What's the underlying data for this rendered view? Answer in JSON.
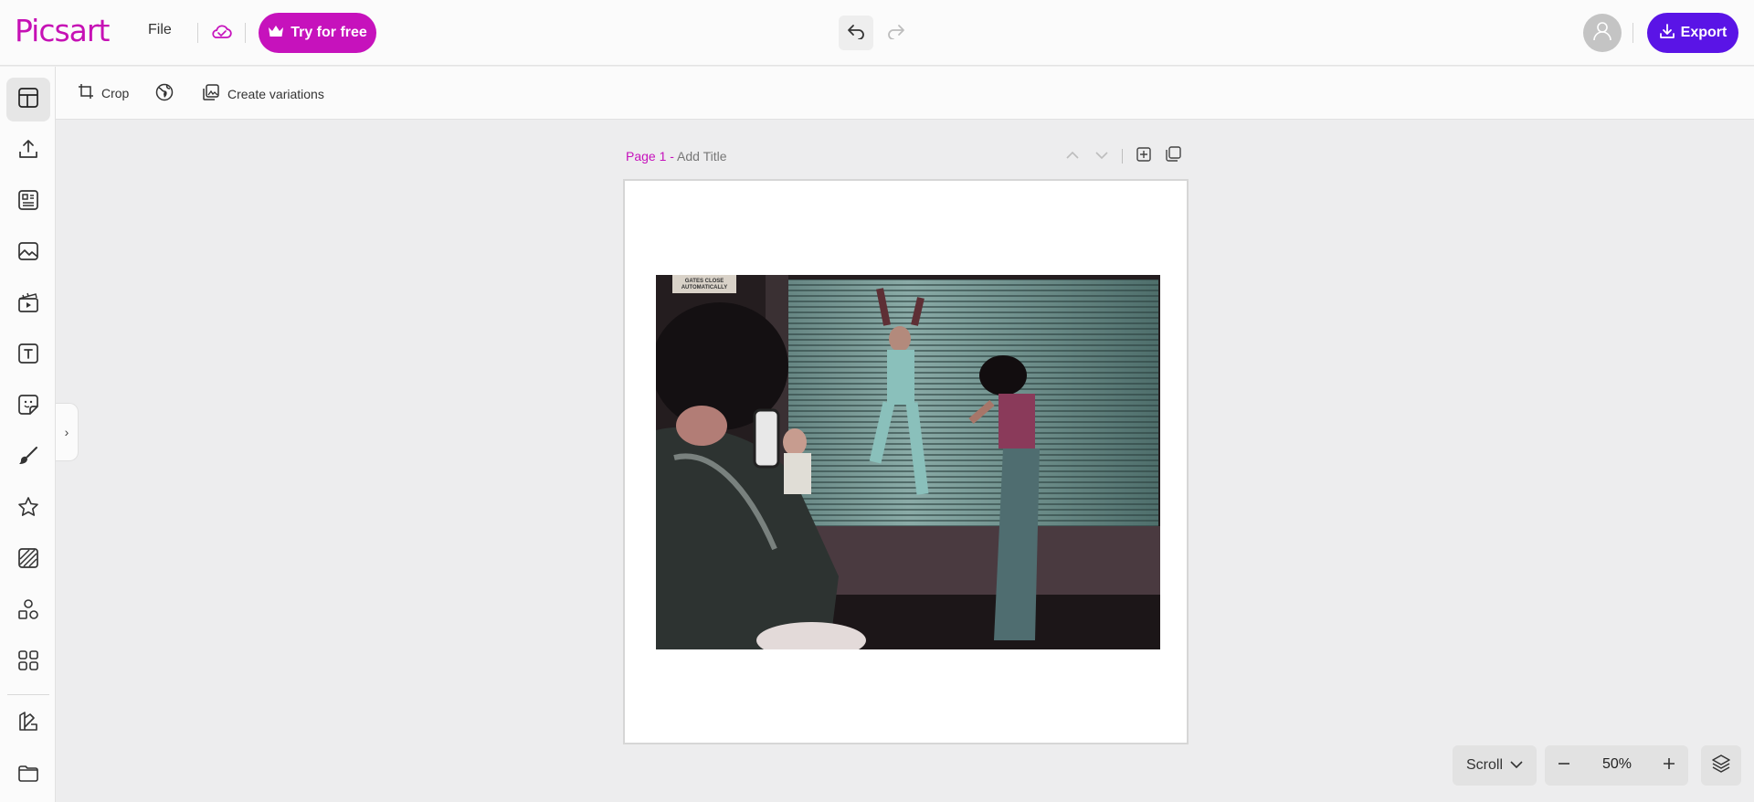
{
  "app": {
    "logo_text": "Picsart",
    "brand_color": "#c612bc",
    "accent_color": "#5a14e6"
  },
  "header": {
    "file_label": "File",
    "try_label": "Try for free",
    "export_label": "Export",
    "icons": [
      "cloud-icon",
      "crown-icon",
      "undo-icon",
      "redo-icon",
      "user-icon",
      "download-icon"
    ]
  },
  "toolbar": {
    "crop_label": "Crop",
    "variations_label": "Create variations",
    "icons": [
      "crop-icon",
      "globe-icon",
      "image-variations-icon"
    ]
  },
  "sidebar": {
    "items": [
      {
        "icon": "layout-icon",
        "active": true
      },
      {
        "icon": "upload-icon"
      },
      {
        "icon": "templates-icon"
      },
      {
        "icon": "photos-icon"
      },
      {
        "icon": "video-icon"
      },
      {
        "icon": "text-icon"
      },
      {
        "icon": "sticker-icon"
      },
      {
        "icon": "brush-icon"
      },
      {
        "icon": "star-icon"
      },
      {
        "icon": "background-icon"
      },
      {
        "icon": "elements-icon"
      },
      {
        "icon": "apps-icon"
      },
      {
        "icon": "brand-kit-icon"
      },
      {
        "icon": "folder-icon"
      }
    ]
  },
  "page": {
    "number_label": "Page 1 - ",
    "title_placeholder": "Add Title"
  },
  "photo": {
    "sign_line1": "GATES CLOSE",
    "sign_line2": "AUTOMATICALLY"
  },
  "bottom": {
    "scroll_label": "Scroll",
    "zoom_value": "50%"
  }
}
